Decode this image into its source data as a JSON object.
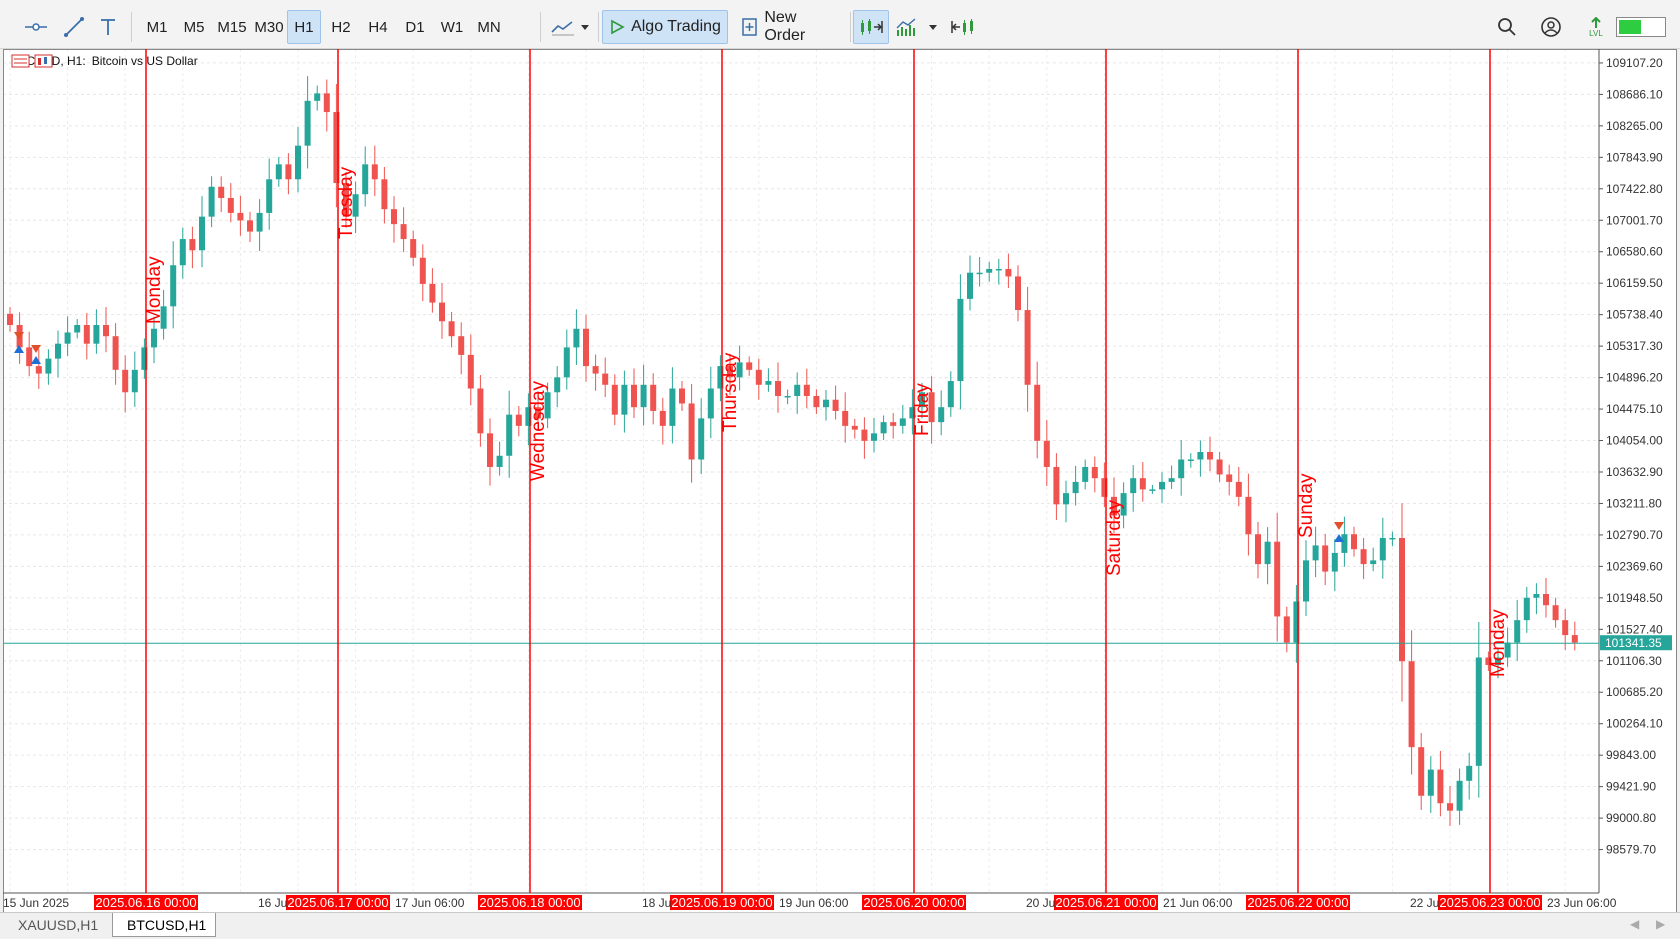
{
  "toolbar": {
    "timeframes": [
      "M1",
      "M5",
      "M15",
      "M30",
      "H1",
      "H2",
      "H4",
      "D1",
      "W1",
      "MN"
    ],
    "active_timeframe": "H1",
    "algo_trading_label": "Algo Trading",
    "new_order_label": "New Order",
    "level_badge": "LVL"
  },
  "chart": {
    "symbol_label": "BTCUSD, H1:",
    "symbol_desc": "Bitcoin vs US Dollar",
    "current_price": "101341.35",
    "current_price_value": 101341.35,
    "price_ticks": [
      "109107.20",
      "108686.10",
      "108265.00",
      "107843.90",
      "107422.80",
      "107001.70",
      "106580.60",
      "106159.50",
      "105738.40",
      "105317.30",
      "104896.20",
      "104475.10",
      "104054.00",
      "103632.90",
      "103211.80",
      "102790.70",
      "102369.60",
      "101948.50",
      "101527.40",
      "101106.30",
      "100685.20",
      "100264.10",
      "99843.00",
      "99421.90",
      "99000.80",
      "98579.70"
    ],
    "time_labels": [
      "15 Jun 2025",
      "16 Ju",
      "17 Jun 06:00",
      "18 Ju",
      "19 Jun 06:00",
      "20 Ju",
      "21 Jun 06:00",
      "22 Ju",
      "23 Jun 06:00"
    ],
    "day_markers": [
      {
        "day": "Monday",
        "date": "2025.06.16 00:00"
      },
      {
        "day": "Tuesday",
        "date": "2025.06.17 00:00"
      },
      {
        "day": "Wednesday",
        "date": "2025.06.18 00:00"
      },
      {
        "day": "Thursday",
        "date": "2025.06.19 00:00"
      },
      {
        "day": "Friday",
        "date": "2025.06.20 00:00"
      },
      {
        "day": "Saturday",
        "date": "2025.06.21 00:00"
      },
      {
        "day": "Sunday",
        "date": "2025.06.22 00:00"
      },
      {
        "day": "Monday",
        "date": "2025.06.23 00:00"
      }
    ],
    "colors": {
      "bull": "#26a69a",
      "bear": "#ef5350",
      "marker": "#ff0000",
      "price_line": "#26a69a"
    }
  },
  "chart_data": {
    "type": "candlestick",
    "title": "BTCUSD, H1: Bitcoin vs US Dollar",
    "y_range": [
      98400,
      109200
    ],
    "start": "2025.06.15 00:00",
    "interval": "1 hour",
    "close": [
      105600,
      105300,
      105050,
      104950,
      105150,
      105350,
      105500,
      105600,
      105350,
      105600,
      105450,
      105000,
      104700,
      105000,
      105300,
      105550,
      105850,
      106400,
      106750,
      106600,
      107050,
      107450,
      107300,
      107100,
      107000,
      106850,
      107100,
      107550,
      107750,
      107550,
      108000,
      108600,
      108700,
      108450,
      107500,
      107050,
      107350,
      107750,
      107550,
      107150,
      106950,
      106750,
      106500,
      106150,
      105900,
      105650,
      105450,
      105200,
      104750,
      104150,
      103700,
      103850,
      104400,
      104250,
      104500,
      104350,
      104700,
      104900,
      105300,
      105550,
      105050,
      104950,
      104800,
      104400,
      104800,
      104500,
      104800,
      104450,
      104250,
      104750,
      104550,
      103800,
      104350,
      104750,
      105050,
      104900,
      105100,
      105000,
      104800,
      104850,
      104650,
      104650,
      104800,
      104650,
      104500,
      104600,
      104450,
      104250,
      104200,
      104050,
      104150,
      104300,
      104250,
      104350,
      104500,
      104700,
      104300,
      104500,
      104850,
      105950,
      106300,
      106300,
      106350,
      106350,
      106250,
      105800,
      104800,
      104050,
      103700,
      103200,
      103350,
      103500,
      103700,
      103550,
      103300,
      103050,
      103350,
      103550,
      103400,
      103400,
      103500,
      103550,
      103800,
      103800,
      103900,
      103800,
      103600,
      103500,
      103300,
      102800,
      102400,
      102700,
      101700,
      101350,
      101900,
      102450,
      102650,
      102300,
      102550,
      102800,
      102600,
      102400,
      102450,
      102750,
      102750,
      101100,
      99950,
      99300,
      99650,
      99200,
      99100,
      99500,
      99700,
      101150,
      101050,
      101150,
      101350,
      101650,
      101950,
      102000,
      101850,
      101650,
      101450,
      101350
    ],
    "day_labels": [
      "Monday",
      "Tuesday",
      "Wednesday",
      "Thursday",
      "Friday",
      "Saturday",
      "Sunday",
      "Monday"
    ]
  },
  "tabs": [
    {
      "label": "XAUUSD,H1",
      "selected": false
    },
    {
      "label": "BTCUSD,H1",
      "selected": true
    }
  ]
}
